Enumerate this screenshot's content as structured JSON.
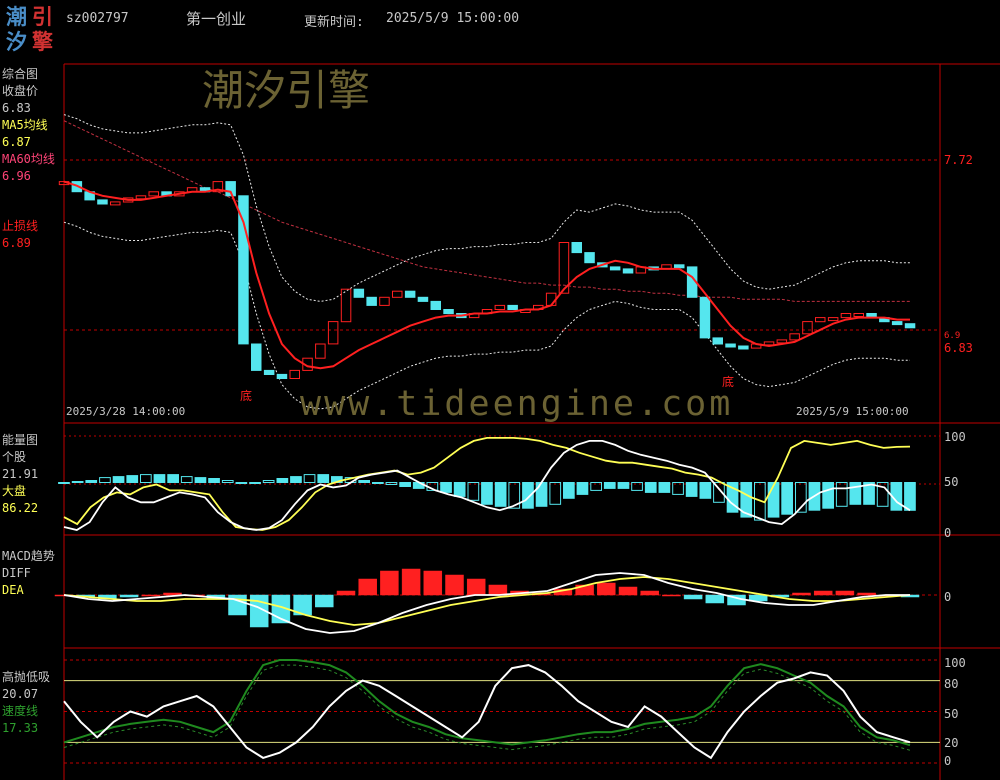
{
  "header": {
    "logo_chars": [
      "潮",
      "引",
      "汐",
      "擎"
    ],
    "stock_code": "sz002797",
    "board": "第一创业",
    "update_label": "更新时间:",
    "update_time": "2025/5/9 15:00:00"
  },
  "watermark": {
    "brand": "潮汐引擎",
    "url": "www.tideengine.com"
  },
  "colors": {
    "cyan": "#55e6ee",
    "red": "#ff2020",
    "yellow": "#ffff55",
    "magenta": "#ff4477",
    "green": "#1f8a1f",
    "frame": "#c00000"
  },
  "panel1": {
    "title": "综合图",
    "close_label": "收盘价",
    "close_value": "6.83",
    "ma5_label": "MA5均线",
    "ma5_value": "6.87",
    "ma60_label": "MA60均线",
    "ma60_value": "6.96",
    "stop_label": "止损线",
    "stop_value": "6.89",
    "axis_high": "7.72",
    "axis_current": "6.83",
    "axis_overlap": "6.9",
    "start_date": "2025/3/28 14:00:00",
    "end_date": "2025/5/9 15:00:00",
    "bottom_marks": [
      "底",
      "底"
    ]
  },
  "panel2": {
    "title": "能量图",
    "stock_label": "个股",
    "stock_value": "21.91",
    "market_label": "大盘",
    "market_value": "86.22",
    "ticks": [
      "100",
      "50",
      "0"
    ]
  },
  "panel3": {
    "title": "MACD趋势",
    "diff_label": "DIFF",
    "dea_label": "DEA",
    "ticks": [
      "0"
    ]
  },
  "panel4": {
    "title": "高抛低吸",
    "value": "20.07",
    "speed_label": "速度线",
    "speed_value": "17.33",
    "ticks": [
      "100",
      "80",
      "50",
      "20",
      "0"
    ]
  },
  "chart_data": [
    {
      "type": "line",
      "name": "综合图",
      "x_range": [
        "2025/3/28 14:00:00",
        "2025/5/9 15:00:00"
      ],
      "ylim": [
        6.4,
        8.1
      ],
      "close": [
        7.55,
        7.5,
        7.46,
        7.44,
        7.45,
        7.47,
        7.48,
        7.5,
        7.48,
        7.5,
        7.52,
        7.5,
        7.55,
        7.48,
        6.75,
        6.62,
        6.6,
        6.58,
        6.62,
        6.68,
        6.75,
        6.86,
        7.02,
        6.98,
        6.94,
        6.98,
        7.01,
        6.98,
        6.96,
        6.92,
        6.9,
        6.88,
        6.9,
        6.92,
        6.94,
        6.92,
        6.92,
        6.94,
        7.0,
        7.25,
        7.2,
        7.15,
        7.13,
        7.12,
        7.1,
        7.13,
        7.12,
        7.14,
        7.13,
        6.98,
        6.78,
        6.75,
        6.74,
        6.73,
        6.75,
        6.76,
        6.77,
        6.8,
        6.86,
        6.88,
        6.88,
        6.9,
        6.9,
        6.88,
        6.86,
        6.85,
        6.83
      ],
      "ma5": [
        7.55,
        7.53,
        7.5,
        7.48,
        7.47,
        7.46,
        7.46,
        7.47,
        7.48,
        7.49,
        7.5,
        7.5,
        7.51,
        7.5,
        7.35,
        7.1,
        6.9,
        6.75,
        6.68,
        6.64,
        6.63,
        6.64,
        6.68,
        6.72,
        6.75,
        6.78,
        6.81,
        6.84,
        6.86,
        6.88,
        6.89,
        6.89,
        6.9,
        6.9,
        6.91,
        6.91,
        6.92,
        6.92,
        6.94,
        7.02,
        7.08,
        7.12,
        7.14,
        7.16,
        7.15,
        7.13,
        7.12,
        7.12,
        7.12,
        7.08,
        7.0,
        6.92,
        6.84,
        6.78,
        6.75,
        6.74,
        6.75,
        6.76,
        6.79,
        6.82,
        6.85,
        6.87,
        6.88,
        6.88,
        6.88,
        6.87,
        6.87
      ],
      "ma60": [
        7.85,
        7.82,
        7.79,
        7.76,
        7.73,
        7.7,
        7.67,
        7.64,
        7.61,
        7.58,
        7.55,
        7.52,
        7.5,
        7.47,
        7.44,
        7.41,
        7.38,
        7.35,
        7.33,
        7.31,
        7.29,
        7.27,
        7.25,
        7.23,
        7.21,
        7.19,
        7.17,
        7.15,
        7.13,
        7.12,
        7.11,
        7.1,
        7.09,
        7.08,
        7.07,
        7.06,
        7.05,
        7.05,
        7.04,
        7.04,
        7.03,
        7.03,
        7.02,
        7.02,
        7.01,
        7.01,
        7.0,
        7.0,
        6.99,
        6.99,
        6.98,
        6.98,
        6.98,
        6.97,
        6.97,
        6.97,
        6.97,
        6.96,
        6.96,
        6.96,
        6.96,
        6.96,
        6.96,
        6.96,
        6.96,
        6.96,
        6.96
      ],
      "stop": [
        6.89
      ]
    },
    {
      "type": "line",
      "name": "能量图",
      "ylim": [
        0,
        100
      ],
      "series": [
        {
          "name": "个股",
          "values": [
            5,
            2,
            10,
            30,
            45,
            35,
            30,
            30,
            35,
            40,
            38,
            35,
            20,
            10,
            4,
            2,
            4,
            12,
            28,
            42,
            48,
            45,
            47,
            55,
            58,
            60,
            62,
            55,
            48,
            42,
            38,
            35,
            30,
            25,
            22,
            26,
            32,
            45,
            65,
            80,
            88,
            92,
            92,
            88,
            82,
            78,
            75,
            72,
            68,
            65,
            60,
            45,
            30,
            20,
            15,
            10,
            8,
            18,
            32,
            40,
            44,
            44,
            46,
            48,
            45,
            30,
            21.91
          ]
        },
        {
          "name": "大盘",
          "values": [
            15,
            8,
            25,
            35,
            40,
            38,
            45,
            48,
            42,
            42,
            40,
            38,
            20,
            5,
            3,
            2,
            5,
            12,
            25,
            40,
            48,
            52,
            55,
            58,
            60,
            62,
            58,
            60,
            65,
            75,
            85,
            92,
            95,
            95,
            95,
            94,
            92,
            88,
            85,
            80,
            76,
            72,
            70,
            70,
            68,
            66,
            64,
            60,
            58,
            55,
            48,
            42,
            35,
            30,
            55,
            85,
            92,
            90,
            88,
            90,
            92,
            88,
            85,
            86,
            86.22
          ]
        }
      ],
      "bars": [
        50,
        51,
        52,
        55,
        56,
        57,
        58,
        58,
        58,
        56,
        55,
        54,
        52,
        50,
        50,
        52,
        54,
        56,
        58,
        58,
        56,
        55,
        52,
        50,
        48,
        46,
        44,
        42,
        40,
        36,
        32,
        28,
        26,
        24,
        24,
        26,
        28,
        34,
        38,
        42,
        44,
        44,
        42,
        40,
        40,
        38,
        36,
        34,
        30,
        20,
        15,
        12,
        15,
        18,
        20,
        22,
        24,
        26,
        28,
        28,
        26,
        22,
        21.91
      ]
    },
    {
      "type": "bar",
      "name": "MACD趋势",
      "ylim": [
        -0.25,
        0.25
      ],
      "series": [
        {
          "name": "DIFF",
          "values": [
            0.0,
            -0.02,
            -0.03,
            -0.02,
            -0.01,
            0.0,
            -0.01,
            -0.02,
            -0.06,
            -0.12,
            -0.17,
            -0.19,
            -0.18,
            -0.14,
            -0.09,
            -0.05,
            -0.02,
            0.0,
            0.0,
            0.01,
            0.02,
            0.06,
            0.1,
            0.11,
            0.1,
            0.06,
            0.03,
            0.01,
            -0.02,
            -0.04,
            -0.05,
            -0.05,
            -0.03,
            -0.01,
            0.0,
            0.0
          ]
        },
        {
          "name": "DEA",
          "values": [
            0.0,
            -0.01,
            -0.02,
            -0.03,
            -0.03,
            -0.02,
            -0.02,
            -0.02,
            -0.03,
            -0.06,
            -0.1,
            -0.13,
            -0.15,
            -0.14,
            -0.11,
            -0.08,
            -0.05,
            -0.03,
            -0.01,
            0.0,
            0.01,
            0.03,
            0.06,
            0.08,
            0.09,
            0.08,
            0.06,
            0.04,
            0.02,
            0.0,
            -0.02,
            -0.03,
            -0.03,
            -0.02,
            -0.01,
            0.0
          ]
        }
      ],
      "macd_bars": [
        0,
        -0.01,
        -0.02,
        -0.01,
        0,
        0.01,
        0,
        -0.02,
        -0.1,
        -0.16,
        -0.14,
        -0.1,
        -0.06,
        0.02,
        0.08,
        0.12,
        0.13,
        0.12,
        0.1,
        0.08,
        0.05,
        0.02,
        0.01,
        0.03,
        0.05,
        0.06,
        0.04,
        0.02,
        0.0,
        -0.02,
        -0.04,
        -0.05,
        -0.03,
        -0.01,
        0.01,
        0.02,
        0.02,
        0.01,
        0.0,
        -0.01
      ]
    },
    {
      "type": "line",
      "name": "高抛低吸",
      "ylim": [
        0,
        100
      ],
      "series": [
        {
          "name": "高抛低吸",
          "values": [
            60,
            40,
            25,
            40,
            50,
            45,
            55,
            60,
            65,
            55,
            35,
            15,
            5,
            10,
            20,
            35,
            55,
            70,
            80,
            75,
            65,
            55,
            45,
            35,
            25,
            40,
            75,
            92,
            95,
            88,
            75,
            60,
            50,
            40,
            35,
            55,
            45,
            30,
            15,
            5,
            30,
            50,
            65,
            78,
            82,
            88,
            85,
            70,
            45,
            30,
            25,
            20.07
          ]
        },
        {
          "name": "速度线",
          "values": [
            20,
            25,
            30,
            35,
            38,
            40,
            42,
            40,
            35,
            30,
            40,
            70,
            95,
            100,
            100,
            98,
            95,
            88,
            75,
            60,
            48,
            40,
            35,
            28,
            24,
            22,
            20,
            18,
            20,
            22,
            25,
            28,
            30,
            30,
            33,
            38,
            40,
            42,
            45,
            55,
            75,
            92,
            96,
            92,
            85,
            78,
            65,
            55,
            35,
            25,
            22,
            17.33
          ]
        }
      ]
    }
  ]
}
